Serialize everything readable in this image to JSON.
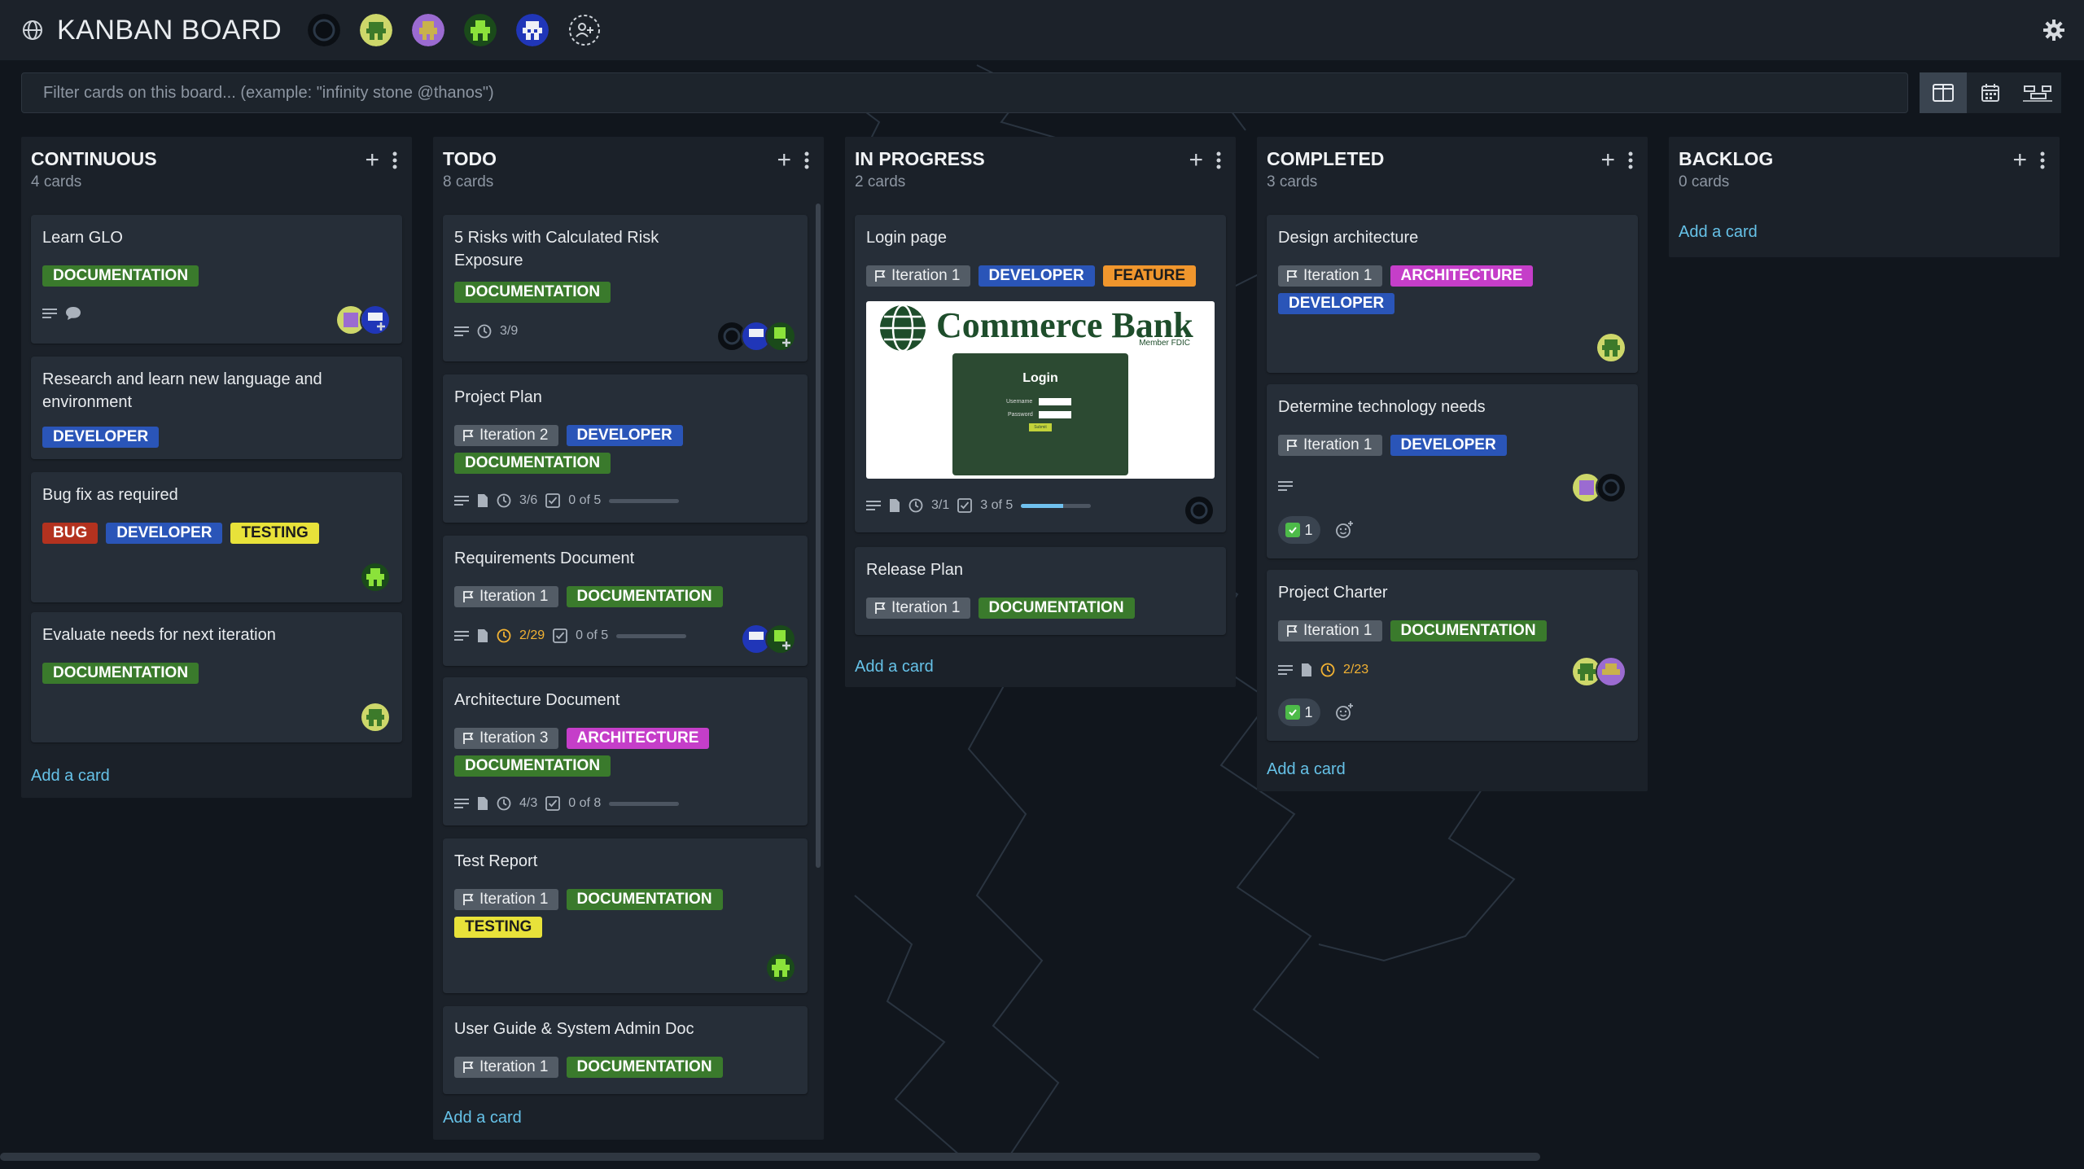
{
  "header": {
    "title": "KANBAN BOARD",
    "avatars": [
      "team-avatar-dark",
      "team-avatar-green",
      "team-avatar-purple",
      "team-avatar-lime",
      "team-avatar-blue"
    ],
    "add_member_icon": "add-member-icon",
    "settings_icon": "gear-icon"
  },
  "filter": {
    "placeholder": "Filter cards on this board... (example: \"infinity stone @thanos\")"
  },
  "views": {
    "selected": "board-view-icon",
    "items": [
      "board-view-icon",
      "calendar-view-icon",
      "timeline-view-icon"
    ]
  },
  "colors": {
    "documentation": "#3a7a2c",
    "developer": "#2a55b8",
    "bug": "#b3321f",
    "testing": "#e8e23a",
    "feature": "#f0962d",
    "architecture": "#c53ec9",
    "iteration": "#535c66"
  },
  "add_card_label": "Add a card",
  "columns": [
    {
      "title": "CONTINUOUS",
      "count": "4 cards",
      "cards": [
        {
          "title": "Learn GLO",
          "labels": [
            "DOCUMENTATION"
          ]
        },
        {
          "title": "Research and learn new language and environment",
          "labels": [
            "DEVELOPER"
          ]
        },
        {
          "title": "Bug fix as required",
          "labels": [
            "BUG",
            "DEVELOPER",
            "TESTING"
          ]
        },
        {
          "title": "Evaluate needs for next iteration",
          "labels": [
            "DOCUMENTATION"
          ]
        }
      ]
    },
    {
      "title": "TODO",
      "count": "8 cards",
      "cards": [
        {
          "title": "5 Risks with Calculated Risk Exposure",
          "labels": [
            "DOCUMENTATION"
          ],
          "due": "3/9"
        },
        {
          "title": "Project Plan",
          "iteration": "Iteration 2",
          "labels": [
            "DEVELOPER",
            "DOCUMENTATION"
          ],
          "due": "3/6",
          "checklist": "0 of 5",
          "progress": 0
        },
        {
          "title": "Requirements Document",
          "iteration": "Iteration 1",
          "labels": [
            "DOCUMENTATION"
          ],
          "due": "2/29",
          "checklist": "0 of 5",
          "progress": 0
        },
        {
          "title": "Architecture Document",
          "iteration": "Iteration 3",
          "labels": [
            "ARCHITECTURE",
            "DOCUMENTATION"
          ],
          "due": "4/3",
          "checklist": "0 of 8",
          "progress": 0
        },
        {
          "title": "Test Report",
          "iteration": "Iteration 1",
          "labels": [
            "DOCUMENTATION",
            "TESTING"
          ]
        },
        {
          "title": "User Guide & System Admin Doc",
          "iteration": "Iteration 1",
          "labels": [
            "DOCUMENTATION"
          ]
        }
      ]
    },
    {
      "title": "IN PROGRESS",
      "count": "2 cards",
      "cards": [
        {
          "title": "Login page",
          "iteration": "Iteration 1",
          "labels": [
            "DEVELOPER",
            "FEATURE"
          ],
          "due": "3/1",
          "checklist": "3 of 5",
          "progress": 0.6,
          "image": {
            "brand": "Commerce Bank",
            "fdic": "Member FDIC",
            "panel_title": "Login",
            "username": "Username",
            "password": "Password",
            "submit": "Submit"
          }
        },
        {
          "title": "Release Plan",
          "iteration": "Iteration 1",
          "labels": [
            "DOCUMENTATION"
          ]
        }
      ]
    },
    {
      "title": "COMPLETED",
      "count": "3 cards",
      "cards": [
        {
          "title": "Design architecture",
          "iteration": "Iteration 1",
          "labels": [
            "ARCHITECTURE",
            "DEVELOPER"
          ]
        },
        {
          "title": "Determine technology needs",
          "iteration": "Iteration 1",
          "labels": [
            "DEVELOPER"
          ],
          "reaction_count": "1"
        },
        {
          "title": "Project Charter",
          "iteration": "Iteration 1",
          "labels": [
            "DOCUMENTATION"
          ],
          "due": "2/23",
          "reaction_count": "1"
        }
      ]
    },
    {
      "title": "BACKLOG",
      "count": "0 cards",
      "cards": []
    }
  ]
}
